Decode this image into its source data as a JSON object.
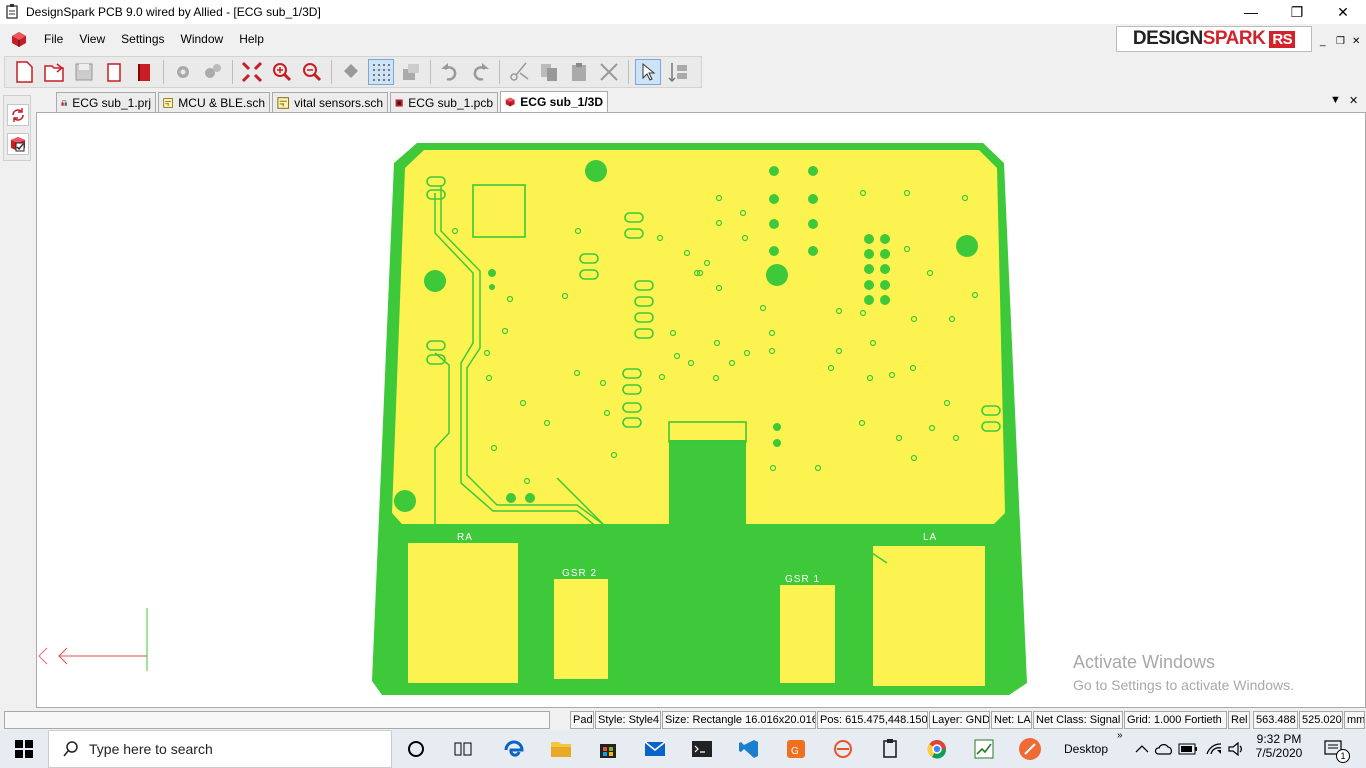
{
  "window": {
    "title": "DesignSpark PCB 9.0 wired by Allied - [ECG sub_1/3D]",
    "minimize_symbol": "—",
    "restore_symbol": "❐",
    "close_symbol": "✕"
  },
  "menu": {
    "items": [
      {
        "label": "File"
      },
      {
        "label": "View"
      },
      {
        "label": "Settings"
      },
      {
        "label": "Window"
      },
      {
        "label": "Help"
      }
    ]
  },
  "logo": {
    "part1": "DESIGN",
    "part2": "SPARK",
    "badge": "RS"
  },
  "mdi": {
    "minimize": "_",
    "restore": "❐",
    "close": "✕"
  },
  "toolbar": {
    "icons": [
      "new-file-icon",
      "open-file-icon",
      "save-icon",
      "save-all-icon",
      "library-book-icon",
      "settings-gear-icon",
      "design-rules-icon",
      "zoom-fit-icon",
      "zoom-in-icon",
      "zoom-out-icon",
      "fill-bucket-icon",
      "grid-icon",
      "layer-icon",
      "undo-icon",
      "redo-icon",
      "cut-icon",
      "copy-icon",
      "paste-icon",
      "delete-icon",
      "select-pointer-icon",
      "properties-icon"
    ]
  },
  "tabs": [
    {
      "label": "ECG sub_1.prj",
      "icon": "project-icon"
    },
    {
      "label": "MCU & BLE.sch",
      "icon": "schematic-icon"
    },
    {
      "label": "vital sensors.sch",
      "icon": "schematic-icon"
    },
    {
      "label": "ECG sub_1.pcb",
      "icon": "pcb-icon"
    },
    {
      "label": "ECG sub_1/3D",
      "icon": "3d-cube-icon",
      "active": true
    }
  ],
  "tab_controls": {
    "dropdown": "▼",
    "close": "✕"
  },
  "pcb": {
    "board_color": "#3dc93a",
    "copper_color": "#fdf350",
    "pad_labels": [
      "RA",
      "GSR 2",
      "GSR 1",
      "LA"
    ]
  },
  "watermark": {
    "line1": "Activate Windows",
    "line2": "Go to Settings to activate Windows."
  },
  "status": {
    "item": "Pad",
    "style": "Style: Style4",
    "size": "Size: Rectangle 16.016x20.016",
    "pos": "Pos: 615.475,448.150",
    "layer": "Layer: GND",
    "net": "Net: LA",
    "net_class": "Net Class: Signal",
    "grid": "Grid: 1.000 Fortieth",
    "rel": "Rel",
    "x": "563.488",
    "y": "525.020",
    "units": "mm"
  },
  "taskbar": {
    "search_placeholder": "Type here to search",
    "desktop_label": "Desktop",
    "time": "9:32 PM",
    "date": "7/5/2020",
    "notifications": "1",
    "chevron": "»"
  }
}
